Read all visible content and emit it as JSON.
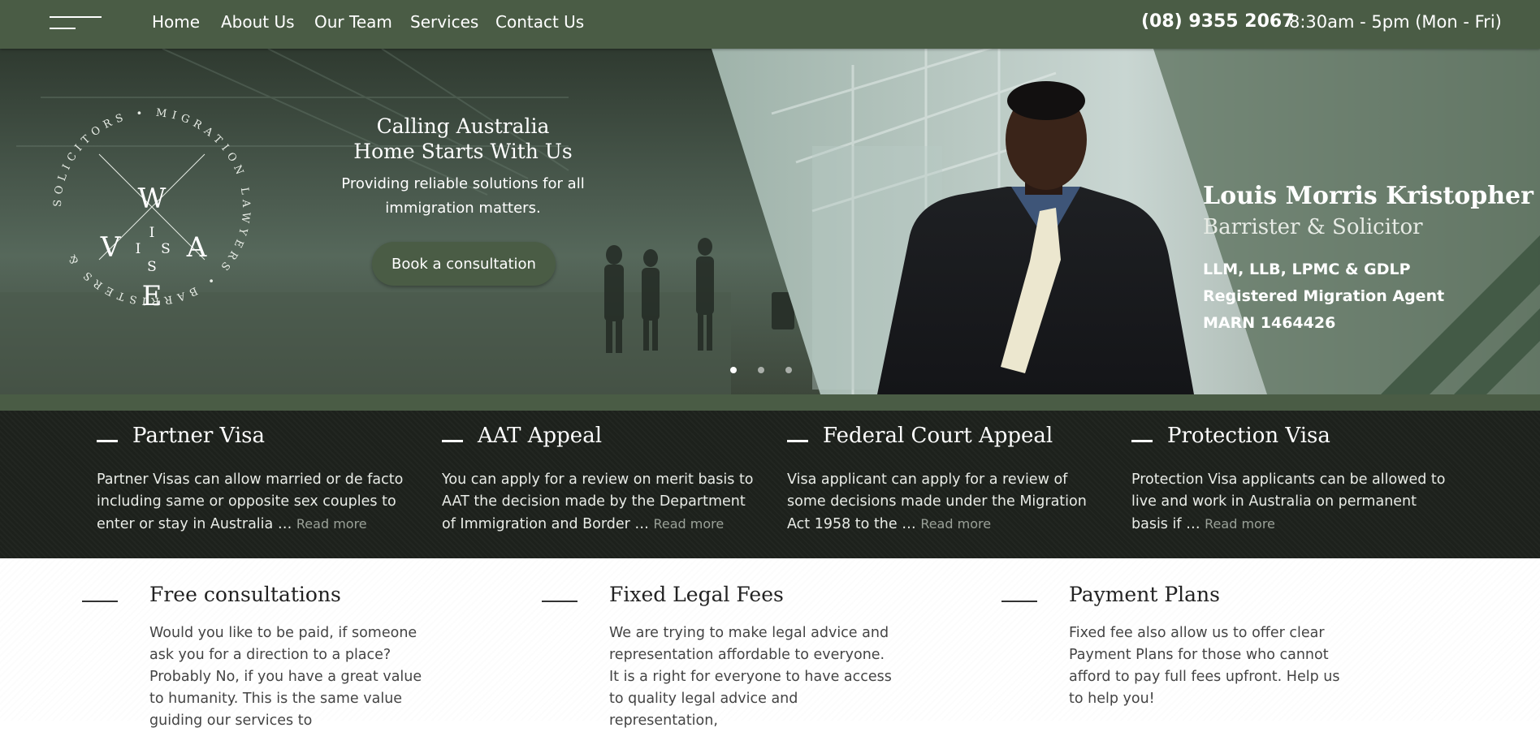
{
  "nav": {
    "items": [
      "Home",
      "About Us",
      "Our Team",
      "Services",
      "Contact Us"
    ],
    "phone": "(08) 9355 2067",
    "hours": "8:30am - 5pm (Mon - Fri)"
  },
  "hero": {
    "logo": {
      "ring_text": "SOLICITORS • MIGRATION LAWYERS • BARRISTERS &",
      "letters": [
        "W",
        "V",
        "A",
        "E",
        "I",
        "S",
        "I",
        "S"
      ]
    },
    "headline_line1": "Calling Australia",
    "headline_line2": "Home Starts With Us",
    "subtext": "Providing reliable solutions for all immigration matters.",
    "cta_label": "Book a consultation",
    "slide_count": 3,
    "active_slide": 1,
    "agent": {
      "name": "Louis Morris Kristopher",
      "title": "Barrister & Solicitor",
      "credentials": [
        "LLM, LLB, LPMC & GDLP",
        "Registered Migration Agent",
        "MARN 1464426"
      ]
    }
  },
  "services": [
    {
      "title": "Partner Visa",
      "body": "Partner Visas can allow married or de facto including same or opposite sex couples to enter or stay in Australia …",
      "link": "Read more"
    },
    {
      "title": "AAT Appeal",
      "body": "You can apply for a review on merit basis to AAT the decision made by the Department of Immigration and Border …",
      "link": "Read more"
    },
    {
      "title": "Federal Court Appeal",
      "body": "Visa applicant can apply for a review of some decisions made under the Migration Act 1958 to the …",
      "link": "Read more"
    },
    {
      "title": "Protection Visa",
      "body": "Protection Visa applicants can be allowed to live and work in Australia on permanent basis if …",
      "link": "Read more"
    }
  ],
  "features": [
    {
      "title": "Free consultations",
      "body": "Would you like to be paid, if someone ask you for a direction to a place? Probably No, if you have a great value to humanity. This is the same value guiding our services to"
    },
    {
      "title": "Fixed Legal Fees",
      "body": "We are trying to make legal advice and representation affordable to everyone. It is a right for everyone to have access to quality legal advice and representation,"
    },
    {
      "title": "Payment Plans",
      "body": "Fixed fee also allow us to offer clear Payment Plans for those who cannot afford to pay full fees upfront. Help us to help you!"
    }
  ],
  "colors": {
    "brand_green": "#4a5c45",
    "dark_band": "#1d211c",
    "white": "#ffffff"
  },
  "icons": [
    "menu-icon",
    "dash-icon"
  ]
}
